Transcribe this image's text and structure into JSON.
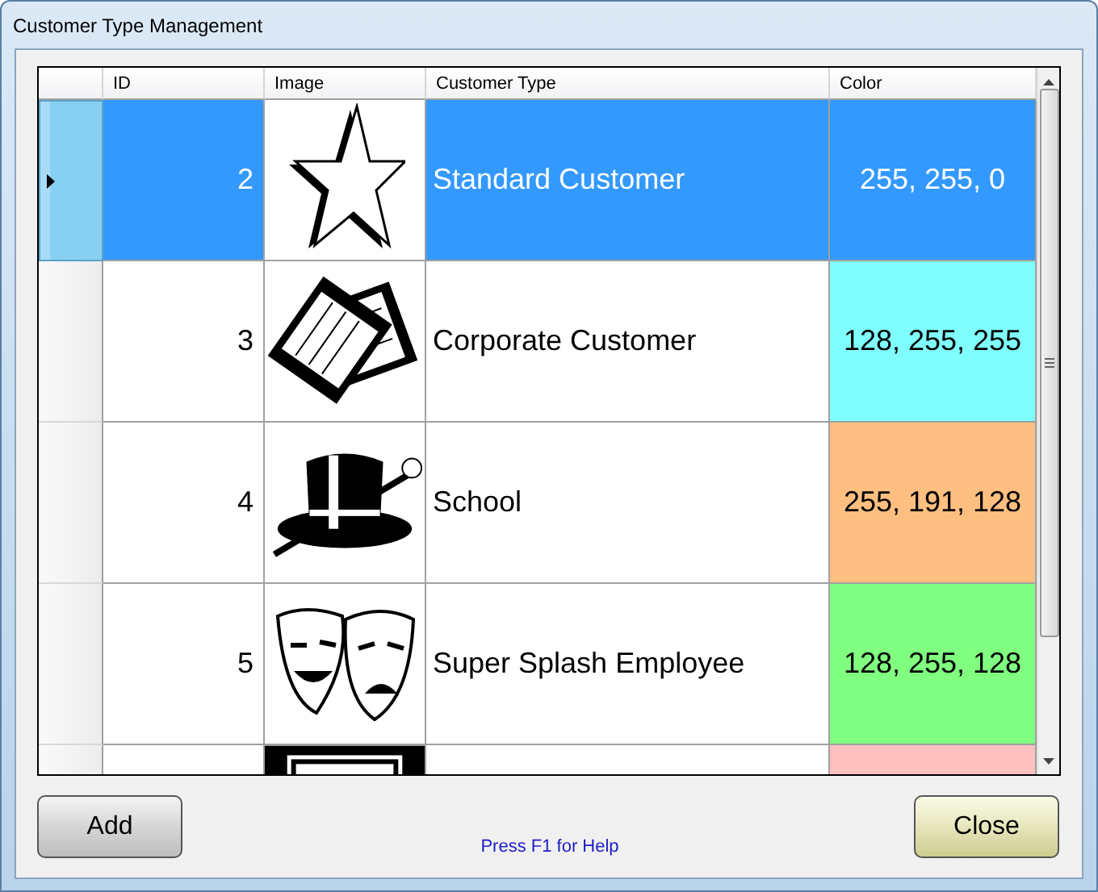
{
  "window": {
    "title": "Customer Type Management"
  },
  "table": {
    "columns": [
      "ID",
      "Image",
      "Customer Type",
      "Color"
    ],
    "rows": [
      {
        "id": "2",
        "customer_type": "Standard Customer",
        "color_value": "255, 255, 0",
        "selected": true
      },
      {
        "id": "3",
        "customer_type": "Corporate Customer",
        "color_value": "128, 255, 255",
        "color": "#80ffff",
        "selected": false
      },
      {
        "id": "4",
        "customer_type": "School",
        "color_value": "255, 191, 128",
        "color": "#ffbf80",
        "selected": false
      },
      {
        "id": "5",
        "customer_type": "Super Splash Employee",
        "color_value": "128, 255, 128",
        "color": "#80ff80",
        "selected": false
      },
      {
        "color": "#ffc0c0",
        "selected": false
      }
    ]
  },
  "buttons": [
    {
      "label": "Add",
      "kind": "plain"
    },
    {
      "label": "Close",
      "kind": "accent"
    }
  ],
  "help_text": "Press F1 for Help"
}
